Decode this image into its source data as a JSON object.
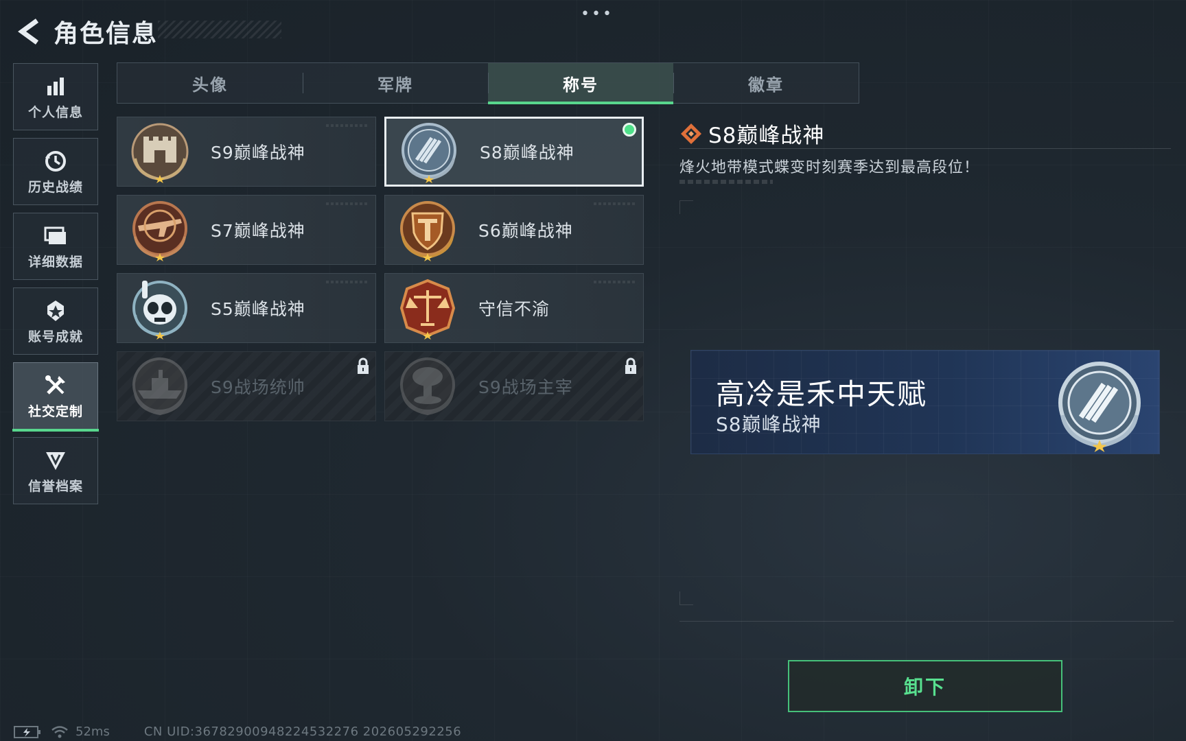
{
  "header": {
    "title": "角色信息",
    "more": "•••"
  },
  "sidebar": {
    "items": [
      {
        "label": "个人信息",
        "icon": "bar-chart-icon"
      },
      {
        "label": "历史战绩",
        "icon": "history-clock-icon"
      },
      {
        "label": "详细数据",
        "icon": "folder-icon"
      },
      {
        "label": "账号成就",
        "icon": "achievement-icon"
      },
      {
        "label": "社交定制",
        "icon": "tools-icon",
        "active": true
      },
      {
        "label": "信誉档案",
        "icon": "credit-shield-icon"
      }
    ]
  },
  "tabs": [
    {
      "label": "头像"
    },
    {
      "label": "军牌"
    },
    {
      "label": "称号",
      "active": true
    },
    {
      "label": "徽章"
    }
  ],
  "titles": [
    {
      "name": "S9巅峰战神",
      "badge": "fortress-badge",
      "state": "owned"
    },
    {
      "name": "S8巅峰战神",
      "badge": "slash-badge",
      "state": "equipped"
    },
    {
      "name": "S7巅峰战神",
      "badge": "rifle-badge",
      "state": "owned"
    },
    {
      "name": "S6巅峰战神",
      "badge": "shield-t-badge",
      "state": "owned"
    },
    {
      "name": "S5巅峰战神",
      "badge": "diver-skull-badge",
      "state": "owned"
    },
    {
      "name": "守信不渝",
      "badge": "scales-badge",
      "state": "owned"
    },
    {
      "name": "S9战场统帅",
      "badge": "warship-badge",
      "state": "locked"
    },
    {
      "name": "S9战场主宰",
      "badge": "mushroom-cloud-badge",
      "state": "locked"
    }
  ],
  "detail": {
    "name": "S8巅峰战神",
    "description": "烽火地带模式蝶变时刻赛季达到最高段位！"
  },
  "preview": {
    "player_name": "高冷是禾中天赋",
    "title": "S8巅峰战神"
  },
  "actions": {
    "unequip_label": "卸下"
  },
  "status": {
    "ping": "52ms",
    "uid": "CN UID:36782900948224532276 202605292256"
  },
  "colors": {
    "accent_green": "#58d68d",
    "selected_border": "#e9eef2",
    "preview_bg": "#203556"
  }
}
